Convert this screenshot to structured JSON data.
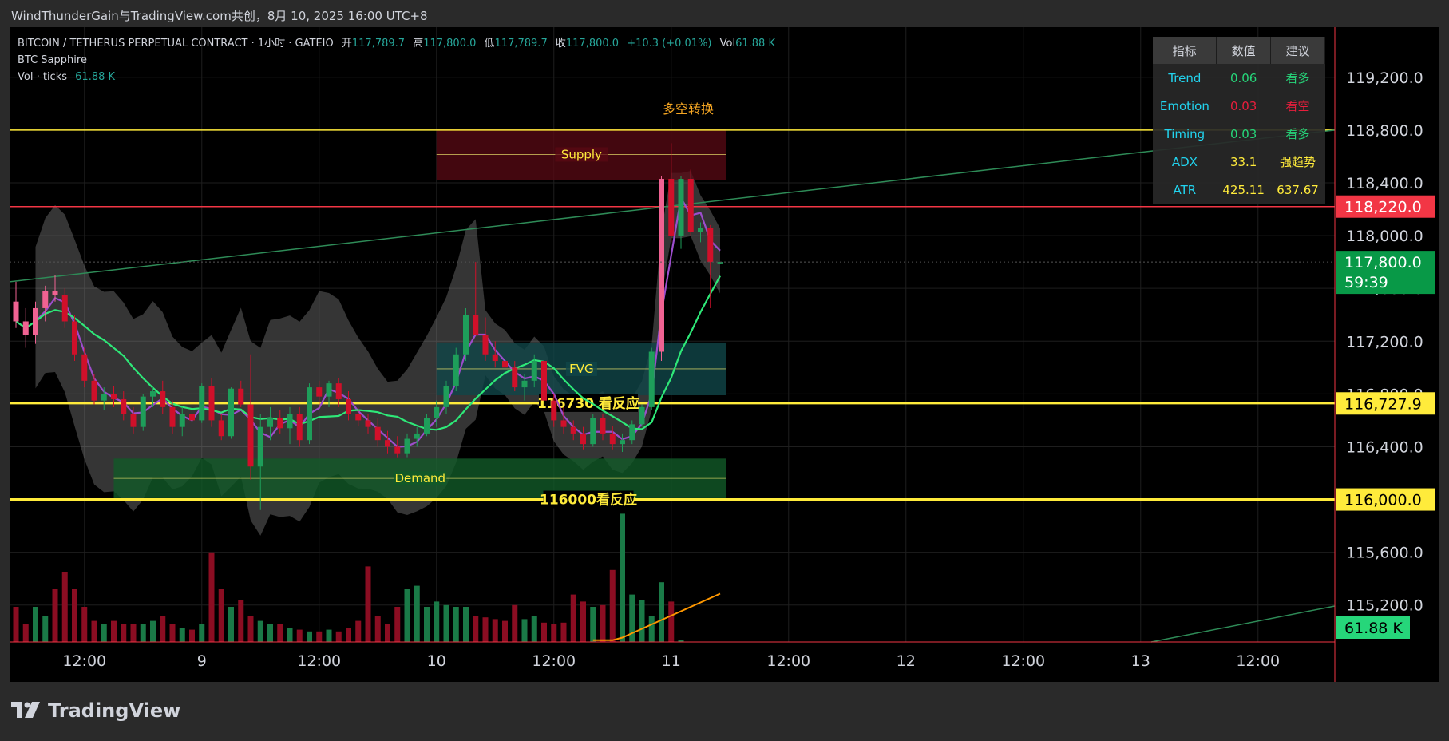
{
  "header": {
    "title": "WindThunderGain与TradingView.com共创，8月 10, 2025 16:00 UTC+8"
  },
  "legend": {
    "symbol": "BITCOIN / TETHERUS PERPETUAL CONTRACT · 1小时 · GATEIO",
    "open_label": "开",
    "open": "117,789.7",
    "high_label": "高",
    "high": "117,800.0",
    "low_label": "低",
    "low": "117,789.7",
    "close_label": "收",
    "close": "117,800.0",
    "change": "+10.3 (+0.01%)",
    "vol_label": "Vol",
    "vol": "61.88 K",
    "indicator": "BTC Sapphire",
    "vol_ticks_label": "Vol · ticks",
    "vol_ticks": "61.88 K"
  },
  "indicator_table": {
    "headers": [
      "指标",
      "数值",
      "建议"
    ],
    "rows": [
      {
        "name": "Trend",
        "value": "0.06",
        "advice": "看多",
        "value_color": "#26d67a",
        "advice_color": "#26d67a"
      },
      {
        "name": "Emotion",
        "value": "0.03",
        "advice": "看空",
        "value_color": "#e91e3c",
        "advice_color": "#e91e3c"
      },
      {
        "name": "Timing",
        "value": "0.03",
        "advice": "看多",
        "value_color": "#26d67a",
        "advice_color": "#26d67a"
      },
      {
        "name": "ADX",
        "value": "33.1",
        "advice": "强趋势",
        "value_color": "#ffeb3b",
        "advice_color": "#ffeb3b"
      },
      {
        "name": "ATR",
        "value": "425.11",
        "advice": "637.67",
        "value_color": "#ffeb3b",
        "advice_color": "#ffeb3b"
      }
    ]
  },
  "footer": {
    "brand": "TradingView"
  },
  "colors": {
    "up": "#1e9e5a",
    "down": "#d0102a",
    "pink": "#f06292",
    "yellow": "#ffeb3b",
    "red_line": "#f23645",
    "trend_line": "#2e8b57",
    "purple": "#9c4dcc",
    "green_line": "#2ee878",
    "bg": "#000000"
  },
  "chart_data": {
    "type": "candlestick",
    "title": "BITCOIN / TETHERUS PERPETUAL CONTRACT · 1小时 · GATEIO",
    "x_tick_labels": [
      "12:00",
      "9",
      "12:00",
      "10",
      "12:00",
      "11",
      "12:00",
      "12",
      "12:00",
      "13",
      "12:00"
    ],
    "y_ticks": [
      "115,200.0",
      "115,600.0",
      "116,000.0",
      "116,400.0",
      "116,800.0",
      "117,200.0",
      "117,600.0",
      "118,000.0",
      "118,400.0",
      "118,800.0",
      "119,200.0"
    ],
    "ylim": [
      114920,
      119580
    ],
    "candles": [
      [
        117500,
        117650,
        117300,
        117350
      ],
      [
        117350,
        117450,
        117150,
        117250
      ],
      [
        117250,
        117500,
        117180,
        117450
      ],
      [
        117450,
        117620,
        117350,
        117580
      ],
      [
        117580,
        117700,
        117500,
        117550
      ],
      [
        117550,
        117600,
        117300,
        117350
      ],
      [
        117350,
        117400,
        117050,
        117100
      ],
      [
        117100,
        117150,
        116850,
        116900
      ],
      [
        116900,
        116950,
        116720,
        116750
      ],
      [
        116750,
        116850,
        116680,
        116800
      ],
      [
        116800,
        116860,
        116700,
        116760
      ],
      [
        116760,
        116820,
        116600,
        116650
      ],
      [
        116650,
        116700,
        116500,
        116550
      ],
      [
        116550,
        116800,
        116520,
        116780
      ],
      [
        116780,
        116850,
        116700,
        116820
      ],
      [
        116820,
        116900,
        116650,
        116700
      ],
      [
        116700,
        116750,
        116500,
        116550
      ],
      [
        116550,
        116700,
        116480,
        116650
      ],
      [
        116650,
        116720,
        116560,
        116600
      ],
      [
        116600,
        116880,
        116580,
        116860
      ],
      [
        116860,
        116920,
        116550,
        116600
      ],
      [
        116600,
        116650,
        116450,
        116480
      ],
      [
        116480,
        116850,
        116460,
        116840
      ],
      [
        116840,
        116900,
        116700,
        116720
      ],
      [
        116720,
        117100,
        116150,
        116250
      ],
      [
        116250,
        116650,
        115920,
        116550
      ],
      [
        116550,
        116700,
        116450,
        116620
      ],
      [
        116620,
        116680,
        116500,
        116540
      ],
      [
        116540,
        116700,
        116420,
        116650
      ],
      [
        116650,
        116700,
        116400,
        116450
      ],
      [
        116450,
        116880,
        116420,
        116850
      ],
      [
        116850,
        116900,
        116700,
        116780
      ],
      [
        116780,
        116900,
        116700,
        116880
      ],
      [
        116880,
        116920,
        116700,
        116760
      ],
      [
        116760,
        116820,
        116600,
        116650
      ],
      [
        116650,
        116700,
        116560,
        116600
      ],
      [
        116600,
        116650,
        116500,
        116550
      ],
      [
        116550,
        116620,
        116400,
        116450
      ],
      [
        116450,
        116520,
        116350,
        116400
      ],
      [
        116400,
        116480,
        116320,
        116350
      ],
      [
        116350,
        116500,
        116320,
        116460
      ],
      [
        116460,
        116550,
        116400,
        116500
      ],
      [
        116500,
        116650,
        116480,
        116620
      ],
      [
        116620,
        116750,
        116550,
        116700
      ],
      [
        116700,
        116900,
        116650,
        116860
      ],
      [
        116860,
        117150,
        116820,
        117100
      ],
      [
        117100,
        117450,
        117050,
        117400
      ],
      [
        117400,
        117800,
        117300,
        117250
      ],
      [
        117250,
        117380,
        117050,
        117100
      ],
      [
        117100,
        117200,
        117000,
        117050
      ],
      [
        117050,
        117100,
        116950,
        117000
      ],
      [
        117000,
        117050,
        116820,
        116850
      ],
      [
        116850,
        116950,
        116750,
        116900
      ],
      [
        116900,
        117100,
        116850,
        117050
      ],
      [
        117050,
        117100,
        116700,
        116750
      ],
      [
        116750,
        116800,
        116550,
        116600
      ],
      [
        116600,
        116700,
        116500,
        116550
      ],
      [
        116550,
        116600,
        116450,
        116500
      ],
      [
        116500,
        116550,
        116380,
        116420
      ],
      [
        116420,
        116650,
        116400,
        116620
      ],
      [
        116620,
        116650,
        116450,
        116500
      ],
      [
        116500,
        116560,
        116380,
        116420
      ],
      [
        116420,
        116500,
        116360,
        116450
      ],
      [
        116450,
        116600,
        116420,
        116570
      ],
      [
        116570,
        116720,
        116550,
        116700
      ],
      [
        116700,
        117150,
        116680,
        117120
      ],
      [
        117120,
        118450,
        117050,
        118430
      ],
      [
        118430,
        118700,
        117950,
        118000
      ],
      [
        118000,
        118450,
        117900,
        118430
      ],
      [
        118430,
        118500,
        118000,
        118030
      ],
      [
        118030,
        118100,
        117950,
        118060
      ],
      [
        118060,
        118080,
        117450,
        117800
      ],
      [
        117789.7,
        117800,
        117789.7,
        117800
      ]
    ],
    "volume": [
      2,
      1,
      2,
      1.5,
      3,
      4,
      3,
      2,
      1.2,
      1,
      1.2,
      1,
      1,
      1,
      1.2,
      1.5,
      1,
      0.8,
      0.7,
      1,
      5.1,
      3,
      2,
      2.4,
      1.5,
      1.2,
      1,
      1,
      0.8,
      0.7,
      0.6,
      0.6,
      0.7,
      0.6,
      0.8,
      1.2,
      4.3,
      1.5,
      1,
      2,
      3,
      3.2,
      2,
      2.3,
      2.1,
      2,
      2,
      1.5,
      1.4,
      1.3,
      1.2,
      2.1,
      1.3,
      1.5,
      1.1,
      1,
      1.1,
      2.7,
      2.3,
      2,
      2.1,
      4.1,
      7.3,
      2.7,
      2.4,
      1.5,
      3.4,
      2.3,
      0.1
    ],
    "volume_unit": "K",
    "horizontal_levels": [
      {
        "price": 118800,
        "color": "#ffeb3b",
        "label": ""
      },
      {
        "price": 118220,
        "color": "#f23645",
        "label": ""
      },
      {
        "price": 116730,
        "color": "#ffeb3b",
        "label": "116730 看反应"
      },
      {
        "price": 116000,
        "color": "#ffeb3b",
        "label": "116000看反应"
      }
    ],
    "zones": [
      {
        "name": "Supply",
        "top": 118810,
        "bottom": 118420,
        "color": "rgba(90,10,20,0.75)"
      },
      {
        "name": "FVG",
        "top": 117190,
        "bottom": 116790,
        "color": "rgba(16,70,72,0.8)"
      },
      {
        "name": "Demand",
        "top": 116310,
        "bottom": 116010,
        "color": "rgba(18,90,40,0.8)"
      }
    ],
    "annotations": [
      "多空转换"
    ],
    "trendline": [
      {
        "x": "08-08 12:00",
        "y": 117650
      },
      {
        "x": "08-13 18:00",
        "y": 118800
      }
    ],
    "price_labels": [
      {
        "value": "118,220.0",
        "bg": "#f23645",
        "fg": "#ffffff"
      },
      {
        "value": "117,800.0",
        "sub": "59:39",
        "bg": "#089947",
        "fg": "#ffffff"
      },
      {
        "value": "116,727.9",
        "bg": "#ffeb3b",
        "fg": "#000000"
      },
      {
        "value": "116,000.0",
        "bg": "#ffeb3b",
        "fg": "#000000"
      },
      {
        "value": "61.88 K",
        "bg": "#26d67a",
        "fg": "#000000"
      }
    ]
  }
}
